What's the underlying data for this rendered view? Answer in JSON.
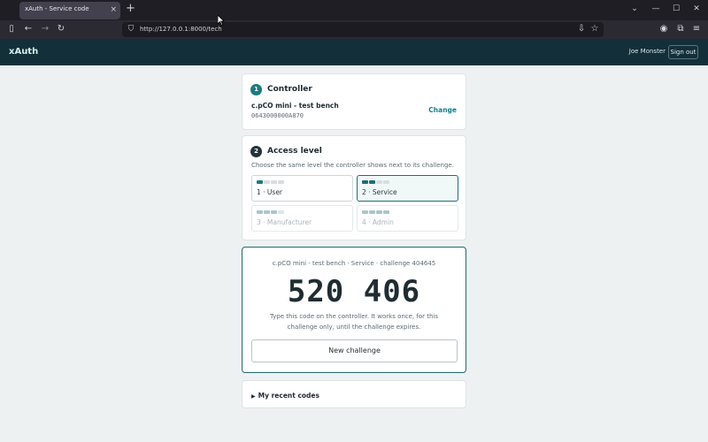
{
  "browser": {
    "tab_title": "xAuth - Service code",
    "tab_close": "×",
    "new_tab": "+",
    "url": "http://127.0.0.1:8000/tech",
    "window_minimize": "—",
    "window_maximize": "☐",
    "window_close": "✕"
  },
  "app": {
    "brand": "xAuth",
    "user_name": "Joe Monster",
    "sign_out_label": "Sign out"
  },
  "controller": {
    "step": "1",
    "title": "Controller",
    "name": "c.pCO mini - test bench",
    "id": "0643000000A870",
    "change_label": "Change"
  },
  "access": {
    "step": "2",
    "title": "Access level",
    "hint": "Choose the same level the controller shows next to its challenge.",
    "levels": [
      {
        "label": "1 · User",
        "pips": 1,
        "state": "normal"
      },
      {
        "label": "2 · Service",
        "pips": 2,
        "state": "selected"
      },
      {
        "label": "3 · Manufacturer",
        "pips": 3,
        "state": "disabled"
      },
      {
        "label": "4 · Admin",
        "pips": 4,
        "state": "disabled"
      }
    ]
  },
  "code_panel": {
    "meta": "c.pCO mini - test bench · Service · challenge 404645",
    "code": "520 406",
    "hint": "Type this code on the controller. It works once, for this challenge only, until the challenge expires.",
    "new_challenge_label": "New challenge"
  },
  "recent": {
    "toggle": "▶",
    "label": "My recent codes"
  },
  "colors": {
    "accent": "#13808a",
    "header_bg": "#13303a",
    "step_active": "#1b7a80",
    "step_dark": "#24333a"
  }
}
